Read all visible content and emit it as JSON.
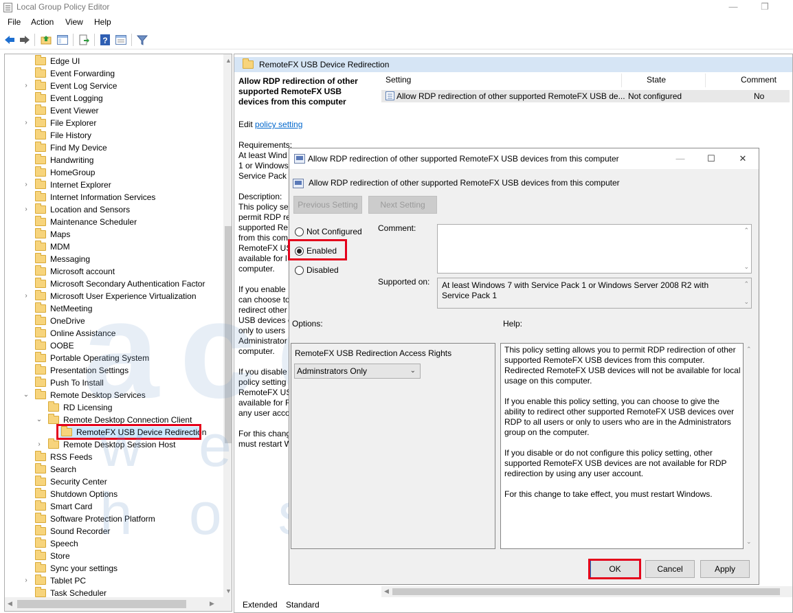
{
  "window": {
    "title": "Local Group Policy Editor",
    "minimize": "—",
    "restore": "❐",
    "menu": [
      "File",
      "Action",
      "View",
      "Help"
    ]
  },
  "tree": {
    "items": [
      {
        "label": "Edge UI",
        "level": 0,
        "expander": ""
      },
      {
        "label": "Event Forwarding",
        "level": 0,
        "expander": ""
      },
      {
        "label": "Event Log Service",
        "level": 0,
        "expander": "›"
      },
      {
        "label": "Event Logging",
        "level": 0,
        "expander": ""
      },
      {
        "label": "Event Viewer",
        "level": 0,
        "expander": ""
      },
      {
        "label": "File Explorer",
        "level": 0,
        "expander": "›"
      },
      {
        "label": "File History",
        "level": 0,
        "expander": ""
      },
      {
        "label": "Find My Device",
        "level": 0,
        "expander": ""
      },
      {
        "label": "Handwriting",
        "level": 0,
        "expander": ""
      },
      {
        "label": "HomeGroup",
        "level": 0,
        "expander": ""
      },
      {
        "label": "Internet Explorer",
        "level": 0,
        "expander": "›"
      },
      {
        "label": "Internet Information Services",
        "level": 0,
        "expander": ""
      },
      {
        "label": "Location and Sensors",
        "level": 0,
        "expander": "›"
      },
      {
        "label": "Maintenance Scheduler",
        "level": 0,
        "expander": ""
      },
      {
        "label": "Maps",
        "level": 0,
        "expander": ""
      },
      {
        "label": "MDM",
        "level": 0,
        "expander": ""
      },
      {
        "label": "Messaging",
        "level": 0,
        "expander": ""
      },
      {
        "label": "Microsoft account",
        "level": 0,
        "expander": ""
      },
      {
        "label": "Microsoft Secondary Authentication Factor",
        "level": 0,
        "expander": ""
      },
      {
        "label": "Microsoft User Experience Virtualization",
        "level": 0,
        "expander": "›"
      },
      {
        "label": "NetMeeting",
        "level": 0,
        "expander": ""
      },
      {
        "label": "OneDrive",
        "level": 0,
        "expander": ""
      },
      {
        "label": "Online Assistance",
        "level": 0,
        "expander": ""
      },
      {
        "label": "OOBE",
        "level": 0,
        "expander": ""
      },
      {
        "label": "Portable Operating System",
        "level": 0,
        "expander": ""
      },
      {
        "label": "Presentation Settings",
        "level": 0,
        "expander": ""
      },
      {
        "label": "Push To Install",
        "level": 0,
        "expander": ""
      },
      {
        "label": "Remote Desktop Services",
        "level": 0,
        "expander": "⌄"
      },
      {
        "label": "RD Licensing",
        "level": 1,
        "expander": ""
      },
      {
        "label": "Remote Desktop Connection Client",
        "level": 1,
        "expander": "⌄"
      },
      {
        "label": "RemoteFX USB Device Redirection",
        "level": 2,
        "expander": ""
      },
      {
        "label": "Remote Desktop Session Host",
        "level": 1,
        "expander": "›"
      },
      {
        "label": "RSS Feeds",
        "level": 0,
        "expander": ""
      },
      {
        "label": "Search",
        "level": 0,
        "expander": ""
      },
      {
        "label": "Security Center",
        "level": 0,
        "expander": ""
      },
      {
        "label": "Shutdown Options",
        "level": 0,
        "expander": ""
      },
      {
        "label": "Smart Card",
        "level": 0,
        "expander": ""
      },
      {
        "label": "Software Protection Platform",
        "level": 0,
        "expander": ""
      },
      {
        "label": "Sound Recorder",
        "level": 0,
        "expander": ""
      },
      {
        "label": "Speech",
        "level": 0,
        "expander": ""
      },
      {
        "label": "Store",
        "level": 0,
        "expander": ""
      },
      {
        "label": "Sync your settings",
        "level": 0,
        "expander": ""
      },
      {
        "label": "Tablet PC",
        "level": 0,
        "expander": "›"
      },
      {
        "label": "Task Scheduler",
        "level": 0,
        "expander": ""
      }
    ]
  },
  "right": {
    "header": "RemoteFX USB Device Redirection",
    "desc_title": "Allow RDP redirection of other supported RemoteFX USB devices from this computer",
    "edit_prefix": "Edit ",
    "edit_link": "policy setting ",
    "requirements": "Requirements:",
    "req_fragments": [
      "At least Wind",
      "1 or Windows",
      "Service Pack 1"
    ],
    "description": "Description:",
    "desc_fragments": [
      "This policy se",
      "permit RDP re",
      "supported Re",
      "from this com",
      "RemoteFX US",
      "available for l",
      "computer.",
      "",
      "If you enable",
      "can choose to",
      "redirect other",
      "USB devices o",
      "only to users",
      "Administrator",
      "computer.",
      "",
      "If you disable",
      "policy setting",
      "RemoteFX US",
      "available for R",
      "any user acco",
      "",
      "For this chang",
      "must restart W"
    ],
    "columns": {
      "setting": "Setting",
      "state": "State",
      "comment": "Comment"
    },
    "row": {
      "setting": "Allow RDP redirection of other supported RemoteFX USB de...",
      "state": "Not configured",
      "comment": "No"
    },
    "tabs": [
      "Extended",
      "Standard"
    ]
  },
  "dialog": {
    "title": "Allow RDP redirection of other supported RemoteFX USB devices from this computer",
    "subtitle": "Allow RDP redirection of other supported RemoteFX USB devices from this computer",
    "prev_btn": "Previous Setting",
    "next_btn": "Next Setting",
    "radio_not_configured": "Not Configured",
    "radio_enabled": "Enabled",
    "radio_disabled": "Disabled",
    "comment_label": "Comment:",
    "supported_label": "Supported on:",
    "supported_text": "At least Windows 7 with Service Pack 1 or Windows Server 2008 R2 with Service Pack 1",
    "options_label": "Options:",
    "help_label": "Help:",
    "option_name": "RemoteFX USB Redirection Access Rights",
    "option_value": "Adminstrators Only",
    "help_paragraphs": [
      "This policy setting allows you to permit RDP redirection of other supported RemoteFX USB devices from this computer. Redirected RemoteFX USB devices will not be available for local usage on this computer.",
      "If you enable this policy setting, you can choose to give the ability to redirect other supported RemoteFX USB devices over RDP to all users or only to users who are in the Administrators group on the computer.",
      "If you disable or do not configure this policy setting, other supported RemoteFX USB devices are not available for RDP redirection by using any user account.",
      "For this change to take effect, you must restart Windows."
    ],
    "ok": "OK",
    "cancel": "Cancel",
    "apply": "Apply"
  },
  "watermark": {
    "big": "accu",
    "small": "web hosting"
  },
  "colors": {
    "highlight_red": "#e4001b",
    "selection_blue": "#cce8ff",
    "header_blue": "#d6e5f5",
    "link_blue": "#0066cc"
  }
}
